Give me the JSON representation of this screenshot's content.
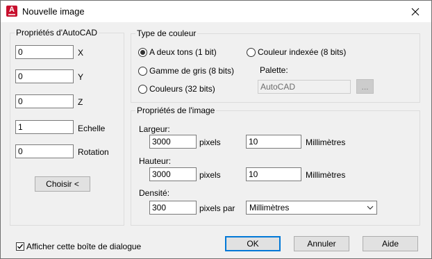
{
  "window": {
    "title": "Nouvelle image",
    "icon_letter": "A"
  },
  "autocad_props": {
    "legend": "Propriétés d'AutoCAD",
    "fields": [
      {
        "value": "0",
        "label": "X"
      },
      {
        "value": "0",
        "label": "Y"
      },
      {
        "value": "0",
        "label": "Z"
      },
      {
        "value": "1",
        "label": "Echelle"
      },
      {
        "value": "0",
        "label": "Rotation"
      }
    ],
    "choose_button": "Choisir <"
  },
  "color_type": {
    "legend": "Type de couleur",
    "options": [
      {
        "label": "A deux tons (1 bit)",
        "checked": true
      },
      {
        "label": "Gamme de gris (8 bits)",
        "checked": false
      },
      {
        "label": "Couleurs (32 bits)",
        "checked": false
      },
      {
        "label": "Couleur indexée (8 bits)",
        "checked": false
      }
    ],
    "palette_label": "Palette:",
    "palette_value": "AutoCAD",
    "palette_browse": "..."
  },
  "image_props": {
    "legend": "Propriétés de l'image",
    "width_label": "Largeur:",
    "width_pixels": "3000",
    "width_mm": "10",
    "height_label": "Hauteur:",
    "height_pixels": "3000",
    "height_mm": "10",
    "density_label": "Densité:",
    "density_value": "300",
    "pixels_unit": "pixels",
    "mm_unit": "Millimètres",
    "pixels_per_label": "pixels par",
    "density_unit": "Millimètres"
  },
  "footer": {
    "show_dialog_label": "Afficher cette boîte de dialogue",
    "show_dialog_checked": true,
    "ok": "OK",
    "cancel": "Annuler",
    "help": "Aide"
  }
}
